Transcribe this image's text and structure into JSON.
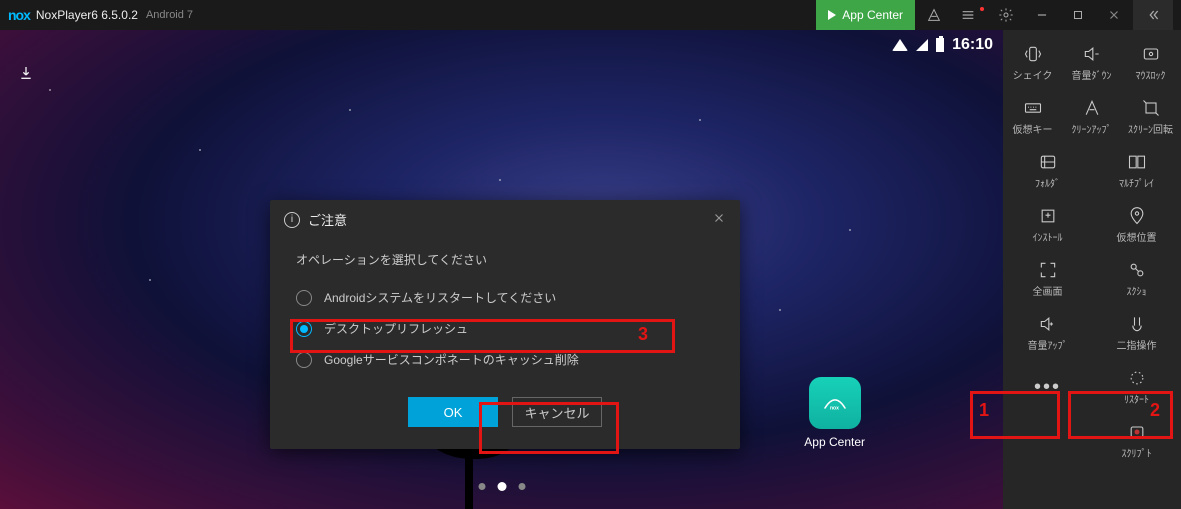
{
  "titlebar": {
    "logo": "nox",
    "title": "NoxPlayer6 6.5.0.2",
    "android": "Android 7",
    "appCenter": "App Center"
  },
  "statusbar": {
    "time": "16:10"
  },
  "desktop": {
    "appCenterLabel": "App Center"
  },
  "dialog": {
    "title": "ご注意",
    "prompt": "オペレーションを選択してください",
    "options": [
      {
        "label": "Androidシステムをリスタートしてください",
        "checked": false
      },
      {
        "label": "デスクトップリフレッシュ",
        "checked": true
      },
      {
        "label": "Googleサービスコンポネートのキャッシュ削除",
        "checked": false
      }
    ],
    "ok": "OK",
    "cancel": "キャンセル"
  },
  "annotations": {
    "n1": "1",
    "n2": "2",
    "n3": "3"
  },
  "toolbar": [
    {
      "id": "shake",
      "label": "シェイク"
    },
    {
      "id": "volume-down",
      "label": "音量ﾀﾞｳﾝ"
    },
    {
      "id": "mouse-lock",
      "label": "ﾏｳｽﾛｯｸ"
    },
    {
      "id": "virtual-key",
      "label": "仮想キー"
    },
    {
      "id": "cleanup",
      "label": "ｸﾘｰﾝｱｯﾌﾟ"
    },
    {
      "id": "rotate",
      "label": "ｽｸﾘｰﾝ回転"
    },
    {
      "id": "folder",
      "label": "ﾌｫﾙﾀﾞ"
    },
    {
      "id": "multiplay",
      "label": "ﾏﾙﾁﾌﾟﾚｲ"
    },
    {
      "id": "install",
      "label": "ｲﾝｽﾄｰﾙ"
    },
    {
      "id": "location",
      "label": "仮想位置"
    },
    {
      "id": "fullscreen",
      "label": "全画面"
    },
    {
      "id": "screenshot",
      "label": "ｽｸｼｮ"
    },
    {
      "id": "volume-up",
      "label": "音量ｱｯﾌﾟ"
    },
    {
      "id": "two-finger",
      "label": "二指操作"
    },
    {
      "id": "more",
      "label": ""
    },
    {
      "id": "restart",
      "label": "ﾘｽﾀｰﾄ"
    },
    {
      "id": "script",
      "label": "ｽｸﾘﾌﾟﾄ"
    }
  ]
}
